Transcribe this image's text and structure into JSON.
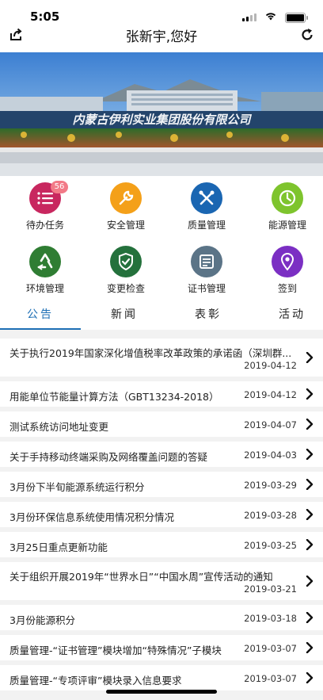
{
  "status_bar": {
    "time": "5:05"
  },
  "header": {
    "title": "张新宇,您好"
  },
  "banner": {
    "sign_text": "内蒙古伊利实业集团股份有限公司"
  },
  "menu": [
    {
      "label": "待办任务",
      "icon": "task-list-icon",
      "color": "#c8275f",
      "badge": "56"
    },
    {
      "label": "安全管理",
      "icon": "wrench-icon",
      "color": "#f4a019"
    },
    {
      "label": "质量管理",
      "icon": "tools-icon",
      "color": "#1a66b2"
    },
    {
      "label": "能源管理",
      "icon": "gauge-icon",
      "color": "#7ec42d"
    },
    {
      "label": "环境管理",
      "icon": "recycle-icon",
      "color": "#2f7d33"
    },
    {
      "label": "变更检查",
      "icon": "shield-check-icon",
      "color": "#24713c"
    },
    {
      "label": "证书管理",
      "icon": "certificate-icon",
      "color": "#5b7487"
    },
    {
      "label": "签到",
      "icon": "location-pin-icon",
      "color": "#7b2fc3"
    }
  ],
  "tabs": [
    "公告",
    "新闻",
    "表彰",
    "活动"
  ],
  "active_tab": "公告",
  "announcements": [
    {
      "title": "关于执行2019年国家深化增值税率改革政策的承诺函（深圳群...",
      "date": "2019-04-12",
      "two_line": true
    },
    {
      "title": "用能单位节能量计算方法（GBT13234-2018）",
      "date": "2019-04-12",
      "two_line": false
    },
    {
      "title": "测试系统访问地址变更",
      "date": "2019-04-07",
      "two_line": false
    },
    {
      "title": "关于手持移动终端采购及网络覆盖问题的答疑",
      "date": "2019-04-03",
      "two_line": false
    },
    {
      "title": "3月份下半旬能源系统运行积分",
      "date": "2019-03-29",
      "two_line": false
    },
    {
      "title": "3月份环保信息系统使用情况积分情况",
      "date": "2019-03-28",
      "two_line": false
    },
    {
      "title": "3月25日重点更新功能",
      "date": "2019-03-25",
      "two_line": false
    },
    {
      "title": "关于组织开展2019年“世界水日”“中国水周”宣传活动的通知",
      "date": "2019-03-21",
      "two_line": true
    },
    {
      "title": "3月份能源积分",
      "date": "2019-03-18",
      "two_line": false
    },
    {
      "title": "质量管理-“证书管理”模块增加“特殊情况”子模块",
      "date": "2019-03-07",
      "two_line": false
    },
    {
      "title": "质量管理-“专项评审”模块录入信息要求",
      "date": "2019-03-07",
      "two_line": false
    }
  ]
}
